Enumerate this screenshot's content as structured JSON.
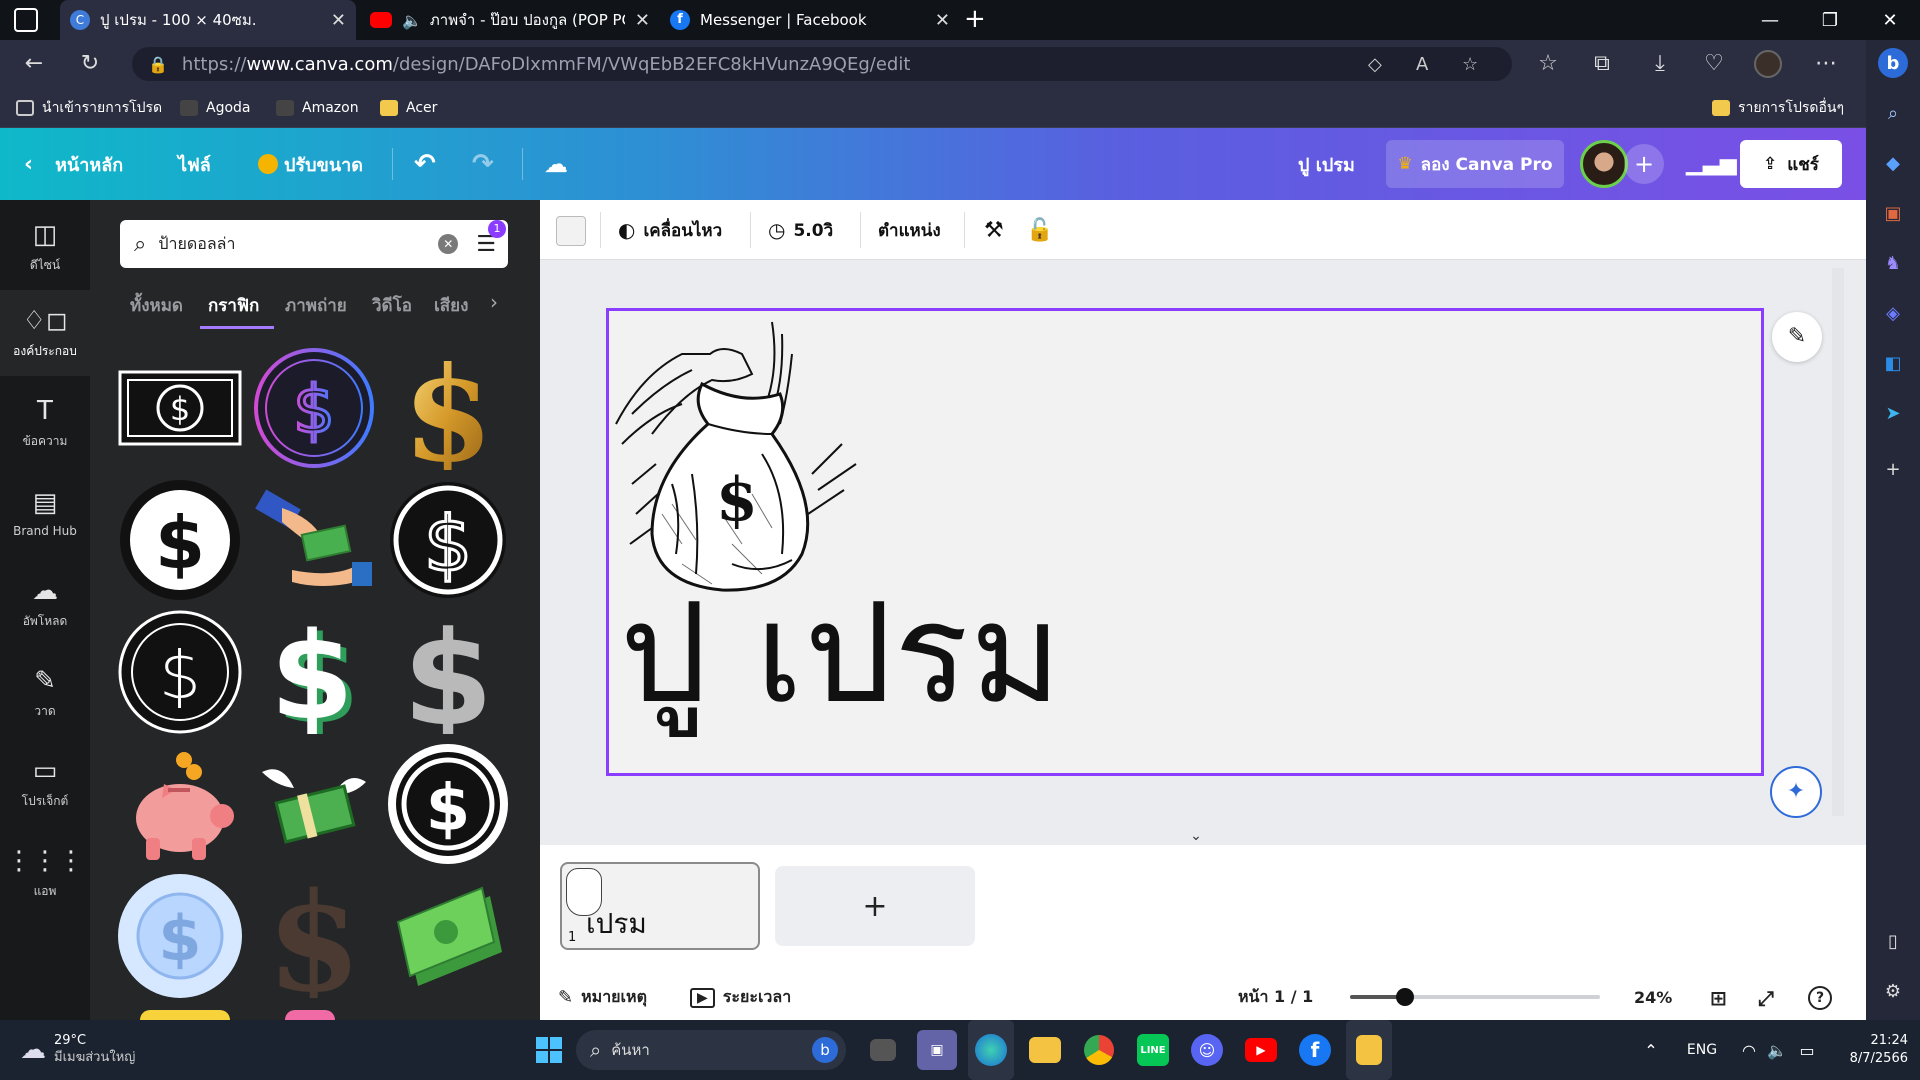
{
  "browser": {
    "tabs": [
      {
        "title": "ปู เปรม - 100 × 40ซม.",
        "icon": "canva-icon",
        "active": true
      },
      {
        "title": "ภาพจำ - ป๊อบ ปองกูล (POP PO",
        "icon": "youtube-icon",
        "active": false
      },
      {
        "title": "Messenger | Facebook",
        "icon": "facebook-icon",
        "active": false
      }
    ],
    "new_tab": "+",
    "url_prefix": "https://",
    "url_host": "www.canva.com",
    "url_path": "/design/DAFoDlxmmFM/VWqEbB2EFC8kHVunzA9QEg/edit",
    "bookmarks": [
      {
        "label": "นำเข้ารายการโปรด",
        "icon": "import-icon"
      },
      {
        "label": "Agoda",
        "icon": "aws-icon"
      },
      {
        "label": "Amazon",
        "icon": "aws-icon"
      },
      {
        "label": "Acer",
        "icon": "folder-icon"
      }
    ],
    "other_favorites": "รายการโปรดอื่นๆ"
  },
  "canva": {
    "header": {
      "home": "หน้าหลัก",
      "file": "ไฟล์",
      "resize": "ปรับขนาด",
      "design_name": "ปู เปรม",
      "try_pro": "ลอง Canva Pro",
      "share": "แชร์"
    },
    "rail": [
      {
        "label": "ดีไซน์",
        "icon": "layout-icon"
      },
      {
        "label": "องค์ประกอบ",
        "icon": "shapes-icon",
        "selected": true
      },
      {
        "label": "ข้อความ",
        "icon": "text-icon"
      },
      {
        "label": "Brand Hub",
        "icon": "brand-icon"
      },
      {
        "label": "อัพโหลด",
        "icon": "upload-icon"
      },
      {
        "label": "วาด",
        "icon": "draw-icon"
      },
      {
        "label": "โปรเจ็กต์",
        "icon": "folder-icon"
      },
      {
        "label": "แอพ",
        "icon": "apps-icon"
      }
    ],
    "panel": {
      "search_value": "ป้ายดอลล่า",
      "filter_badge": "1",
      "tabs": [
        "ทั้งหมด",
        "กราฟิก",
        "ภาพถ่าย",
        "วิดีโอ",
        "เสียง"
      ],
      "active_tab": "กราฟิก"
    },
    "toolbar": {
      "animate": "เคลื่อนไหว",
      "duration": "5.0วิ",
      "position": "ตำแหน่ง"
    },
    "canvas": {
      "title_text": "ปู เปรม",
      "bag_symbol": "$"
    },
    "thumb": {
      "page_number": "1",
      "text": "เปรม"
    },
    "footer": {
      "notes": "หมายเหตุ",
      "timing": "ระยะเวลา",
      "page": "หน้า 1 / 1",
      "zoom": "24%",
      "zoom_value_percent": 24
    }
  },
  "taskbar": {
    "weather_temp": "29°C",
    "weather_desc": "มีเมฆส่วนใหญ่",
    "search": "ค้นหา",
    "lang": "ENG",
    "time": "21:24",
    "date": "8/7/2566"
  },
  "colors": {
    "accent": "#8b3dff",
    "header_start": "#0fb8c9",
    "header_end": "#7a4fe6",
    "taskbar": "#1b2330"
  }
}
